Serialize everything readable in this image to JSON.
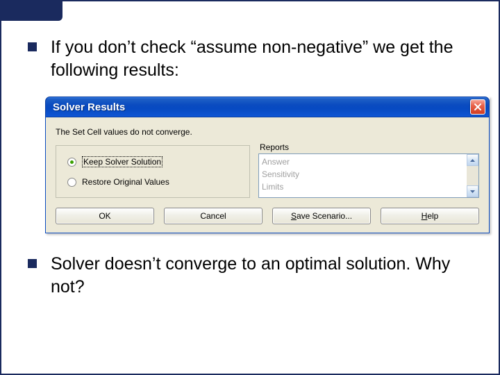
{
  "slide": {
    "bullet1": "If you don’t check “assume non-negative” we get the following results:",
    "bullet2": "Solver doesn’t converge to an optimal solution. Why not?"
  },
  "dialog": {
    "title": "Solver Results",
    "message": "The Set Cell values do not converge.",
    "radio": {
      "keep": "Keep Solver Solution",
      "restore": "Restore Original Values",
      "selected": "keep"
    },
    "reports": {
      "label": "Reports",
      "items": [
        {
          "label": "Answer",
          "enabled": false
        },
        {
          "label": "Sensitivity",
          "enabled": false
        },
        {
          "label": "Limits",
          "enabled": false
        }
      ]
    },
    "buttons": {
      "ok": "OK",
      "cancel": "Cancel",
      "save_prefix": "S",
      "save_rest": "ave Scenario...",
      "help_prefix": "H",
      "help_rest": "elp"
    }
  }
}
